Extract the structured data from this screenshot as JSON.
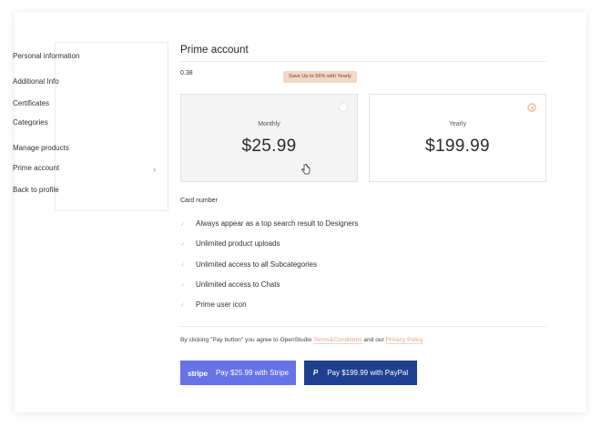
{
  "sidebar": {
    "items": [
      {
        "label": "Personal information"
      },
      {
        "label": "Additional Info"
      },
      {
        "label": "Certificates"
      },
      {
        "label": "Categories"
      },
      {
        "label": "Manage products"
      },
      {
        "label": "Prime account",
        "active": true
      },
      {
        "label": "Back to profile"
      }
    ],
    "chevron": "chevron-right-icon"
  },
  "main": {
    "title": "Prime account",
    "value": "0.38",
    "save_badge": "Save Up  to 56% with Yearly",
    "plans": [
      {
        "name": "Monthly",
        "price": "$25.99",
        "selected": false
      },
      {
        "name": "Yearly",
        "price": "$199.99",
        "selected": true
      }
    ],
    "card_label": "Card number",
    "features": [
      "Always appear as a top search result to Designers",
      "Unlimited product uploads",
      "Unlimited access to all Subcategories",
      "Unlimited access to Chats",
      "Prime user icon"
    ],
    "terms": {
      "prefix": "By clicking \"Pay button\" you agree to OpenStudio",
      "terms_link": "Terms&Conditions",
      "middle": "and our",
      "privacy_link": "Privacy Policy"
    },
    "buttons": {
      "stripe_logo": "stripe",
      "stripe_label": "Pay $25.99 with Stripe",
      "paypal_logo": "P",
      "paypal_label": "Pay $199.99 with PayPal"
    }
  },
  "colors": {
    "accent": "#e7a37f",
    "badge_bg": "#f3d8c8",
    "stripe": "#6772e5",
    "paypal": "#1f3f8f"
  }
}
